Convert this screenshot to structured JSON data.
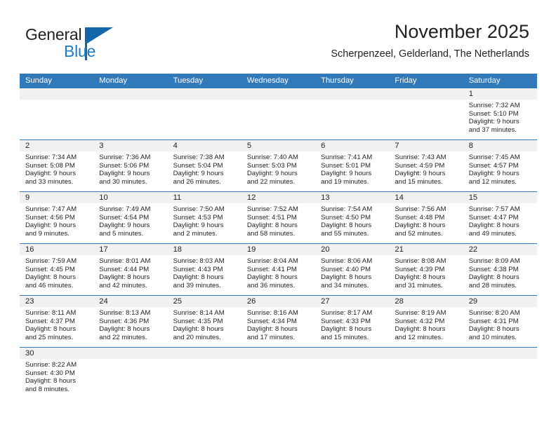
{
  "brand": {
    "name_part1": "General",
    "name_part2": "Blue",
    "triangle_color": "#1466a8",
    "blue_text_color": "#1e7bc4"
  },
  "header": {
    "title": "November 2025",
    "subtitle": "Scherpenzeel, Gelderland, The Netherlands"
  },
  "theme": {
    "header_blue": "#3279b9",
    "day_band_gray": "#f1f1f1",
    "text_color": "#231f20"
  },
  "weekdays": [
    "Sunday",
    "Monday",
    "Tuesday",
    "Wednesday",
    "Thursday",
    "Friday",
    "Saturday"
  ],
  "weeks": [
    [
      {
        "empty": true
      },
      {
        "empty": true
      },
      {
        "empty": true
      },
      {
        "empty": true
      },
      {
        "empty": true
      },
      {
        "empty": true
      },
      {
        "day": "1",
        "sunrise": "Sunrise: 7:32 AM",
        "sunset": "Sunset: 5:10 PM",
        "daylight1": "Daylight: 9 hours",
        "daylight2": "and 37 minutes."
      }
    ],
    [
      {
        "day": "2",
        "sunrise": "Sunrise: 7:34 AM",
        "sunset": "Sunset: 5:08 PM",
        "daylight1": "Daylight: 9 hours",
        "daylight2": "and 33 minutes."
      },
      {
        "day": "3",
        "sunrise": "Sunrise: 7:36 AM",
        "sunset": "Sunset: 5:06 PM",
        "daylight1": "Daylight: 9 hours",
        "daylight2": "and 30 minutes."
      },
      {
        "day": "4",
        "sunrise": "Sunrise: 7:38 AM",
        "sunset": "Sunset: 5:04 PM",
        "daylight1": "Daylight: 9 hours",
        "daylight2": "and 26 minutes."
      },
      {
        "day": "5",
        "sunrise": "Sunrise: 7:40 AM",
        "sunset": "Sunset: 5:03 PM",
        "daylight1": "Daylight: 9 hours",
        "daylight2": "and 22 minutes."
      },
      {
        "day": "6",
        "sunrise": "Sunrise: 7:41 AM",
        "sunset": "Sunset: 5:01 PM",
        "daylight1": "Daylight: 9 hours",
        "daylight2": "and 19 minutes."
      },
      {
        "day": "7",
        "sunrise": "Sunrise: 7:43 AM",
        "sunset": "Sunset: 4:59 PM",
        "daylight1": "Daylight: 9 hours",
        "daylight2": "and 15 minutes."
      },
      {
        "day": "8",
        "sunrise": "Sunrise: 7:45 AM",
        "sunset": "Sunset: 4:57 PM",
        "daylight1": "Daylight: 9 hours",
        "daylight2": "and 12 minutes."
      }
    ],
    [
      {
        "day": "9",
        "sunrise": "Sunrise: 7:47 AM",
        "sunset": "Sunset: 4:56 PM",
        "daylight1": "Daylight: 9 hours",
        "daylight2": "and 9 minutes."
      },
      {
        "day": "10",
        "sunrise": "Sunrise: 7:49 AM",
        "sunset": "Sunset: 4:54 PM",
        "daylight1": "Daylight: 9 hours",
        "daylight2": "and 5 minutes."
      },
      {
        "day": "11",
        "sunrise": "Sunrise: 7:50 AM",
        "sunset": "Sunset: 4:53 PM",
        "daylight1": "Daylight: 9 hours",
        "daylight2": "and 2 minutes."
      },
      {
        "day": "12",
        "sunrise": "Sunrise: 7:52 AM",
        "sunset": "Sunset: 4:51 PM",
        "daylight1": "Daylight: 8 hours",
        "daylight2": "and 58 minutes."
      },
      {
        "day": "13",
        "sunrise": "Sunrise: 7:54 AM",
        "sunset": "Sunset: 4:50 PM",
        "daylight1": "Daylight: 8 hours",
        "daylight2": "and 55 minutes."
      },
      {
        "day": "14",
        "sunrise": "Sunrise: 7:56 AM",
        "sunset": "Sunset: 4:48 PM",
        "daylight1": "Daylight: 8 hours",
        "daylight2": "and 52 minutes."
      },
      {
        "day": "15",
        "sunrise": "Sunrise: 7:57 AM",
        "sunset": "Sunset: 4:47 PM",
        "daylight1": "Daylight: 8 hours",
        "daylight2": "and 49 minutes."
      }
    ],
    [
      {
        "day": "16",
        "sunrise": "Sunrise: 7:59 AM",
        "sunset": "Sunset: 4:45 PM",
        "daylight1": "Daylight: 8 hours",
        "daylight2": "and 46 minutes."
      },
      {
        "day": "17",
        "sunrise": "Sunrise: 8:01 AM",
        "sunset": "Sunset: 4:44 PM",
        "daylight1": "Daylight: 8 hours",
        "daylight2": "and 42 minutes."
      },
      {
        "day": "18",
        "sunrise": "Sunrise: 8:03 AM",
        "sunset": "Sunset: 4:43 PM",
        "daylight1": "Daylight: 8 hours",
        "daylight2": "and 39 minutes."
      },
      {
        "day": "19",
        "sunrise": "Sunrise: 8:04 AM",
        "sunset": "Sunset: 4:41 PM",
        "daylight1": "Daylight: 8 hours",
        "daylight2": "and 36 minutes."
      },
      {
        "day": "20",
        "sunrise": "Sunrise: 8:06 AM",
        "sunset": "Sunset: 4:40 PM",
        "daylight1": "Daylight: 8 hours",
        "daylight2": "and 34 minutes."
      },
      {
        "day": "21",
        "sunrise": "Sunrise: 8:08 AM",
        "sunset": "Sunset: 4:39 PM",
        "daylight1": "Daylight: 8 hours",
        "daylight2": "and 31 minutes."
      },
      {
        "day": "22",
        "sunrise": "Sunrise: 8:09 AM",
        "sunset": "Sunset: 4:38 PM",
        "daylight1": "Daylight: 8 hours",
        "daylight2": "and 28 minutes."
      }
    ],
    [
      {
        "day": "23",
        "sunrise": "Sunrise: 8:11 AM",
        "sunset": "Sunset: 4:37 PM",
        "daylight1": "Daylight: 8 hours",
        "daylight2": "and 25 minutes."
      },
      {
        "day": "24",
        "sunrise": "Sunrise: 8:13 AM",
        "sunset": "Sunset: 4:36 PM",
        "daylight1": "Daylight: 8 hours",
        "daylight2": "and 22 minutes."
      },
      {
        "day": "25",
        "sunrise": "Sunrise: 8:14 AM",
        "sunset": "Sunset: 4:35 PM",
        "daylight1": "Daylight: 8 hours",
        "daylight2": "and 20 minutes."
      },
      {
        "day": "26",
        "sunrise": "Sunrise: 8:16 AM",
        "sunset": "Sunset: 4:34 PM",
        "daylight1": "Daylight: 8 hours",
        "daylight2": "and 17 minutes."
      },
      {
        "day": "27",
        "sunrise": "Sunrise: 8:17 AM",
        "sunset": "Sunset: 4:33 PM",
        "daylight1": "Daylight: 8 hours",
        "daylight2": "and 15 minutes."
      },
      {
        "day": "28",
        "sunrise": "Sunrise: 8:19 AM",
        "sunset": "Sunset: 4:32 PM",
        "daylight1": "Daylight: 8 hours",
        "daylight2": "and 12 minutes."
      },
      {
        "day": "29",
        "sunrise": "Sunrise: 8:20 AM",
        "sunset": "Sunset: 4:31 PM",
        "daylight1": "Daylight: 8 hours",
        "daylight2": "and 10 minutes."
      }
    ],
    [
      {
        "day": "30",
        "sunrise": "Sunrise: 8:22 AM",
        "sunset": "Sunset: 4:30 PM",
        "daylight1": "Daylight: 8 hours",
        "daylight2": "and 8 minutes."
      },
      {
        "empty": true
      },
      {
        "empty": true
      },
      {
        "empty": true
      },
      {
        "empty": true
      },
      {
        "empty": true
      },
      {
        "empty": true
      }
    ]
  ]
}
